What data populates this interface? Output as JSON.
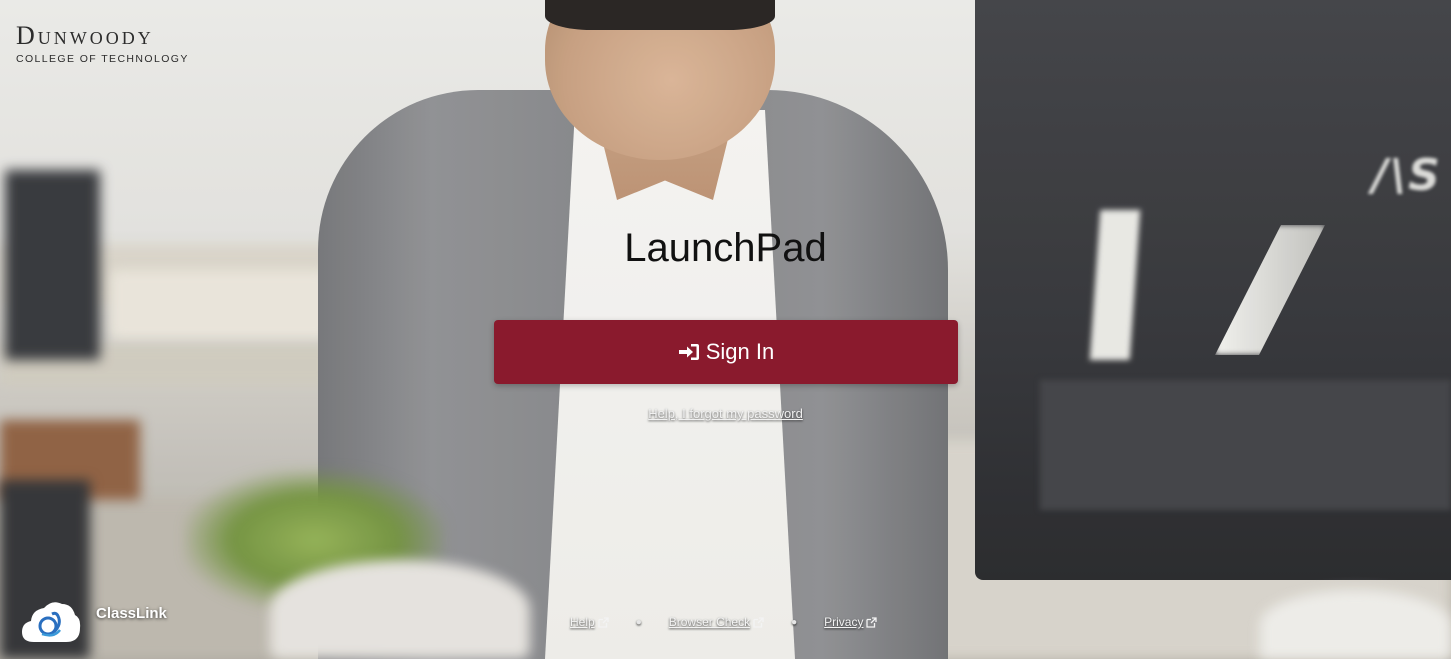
{
  "brand": {
    "name": "Dunwoody",
    "subtitle": "COLLEGE OF TECHNOLOGY"
  },
  "main": {
    "title": "LaunchPad",
    "signin_label": "Sign In",
    "forgot_label": "Help, I forgot my password"
  },
  "footer": {
    "product_name": "ClassLink",
    "links": [
      {
        "label": "Help",
        "icon": "external-link-icon"
      },
      {
        "label": "Browser Check",
        "icon": "external-link-icon"
      },
      {
        "label": "Privacy",
        "icon": "external-link-icon"
      }
    ]
  },
  "colors": {
    "primary_button": "#8a1a2d"
  }
}
